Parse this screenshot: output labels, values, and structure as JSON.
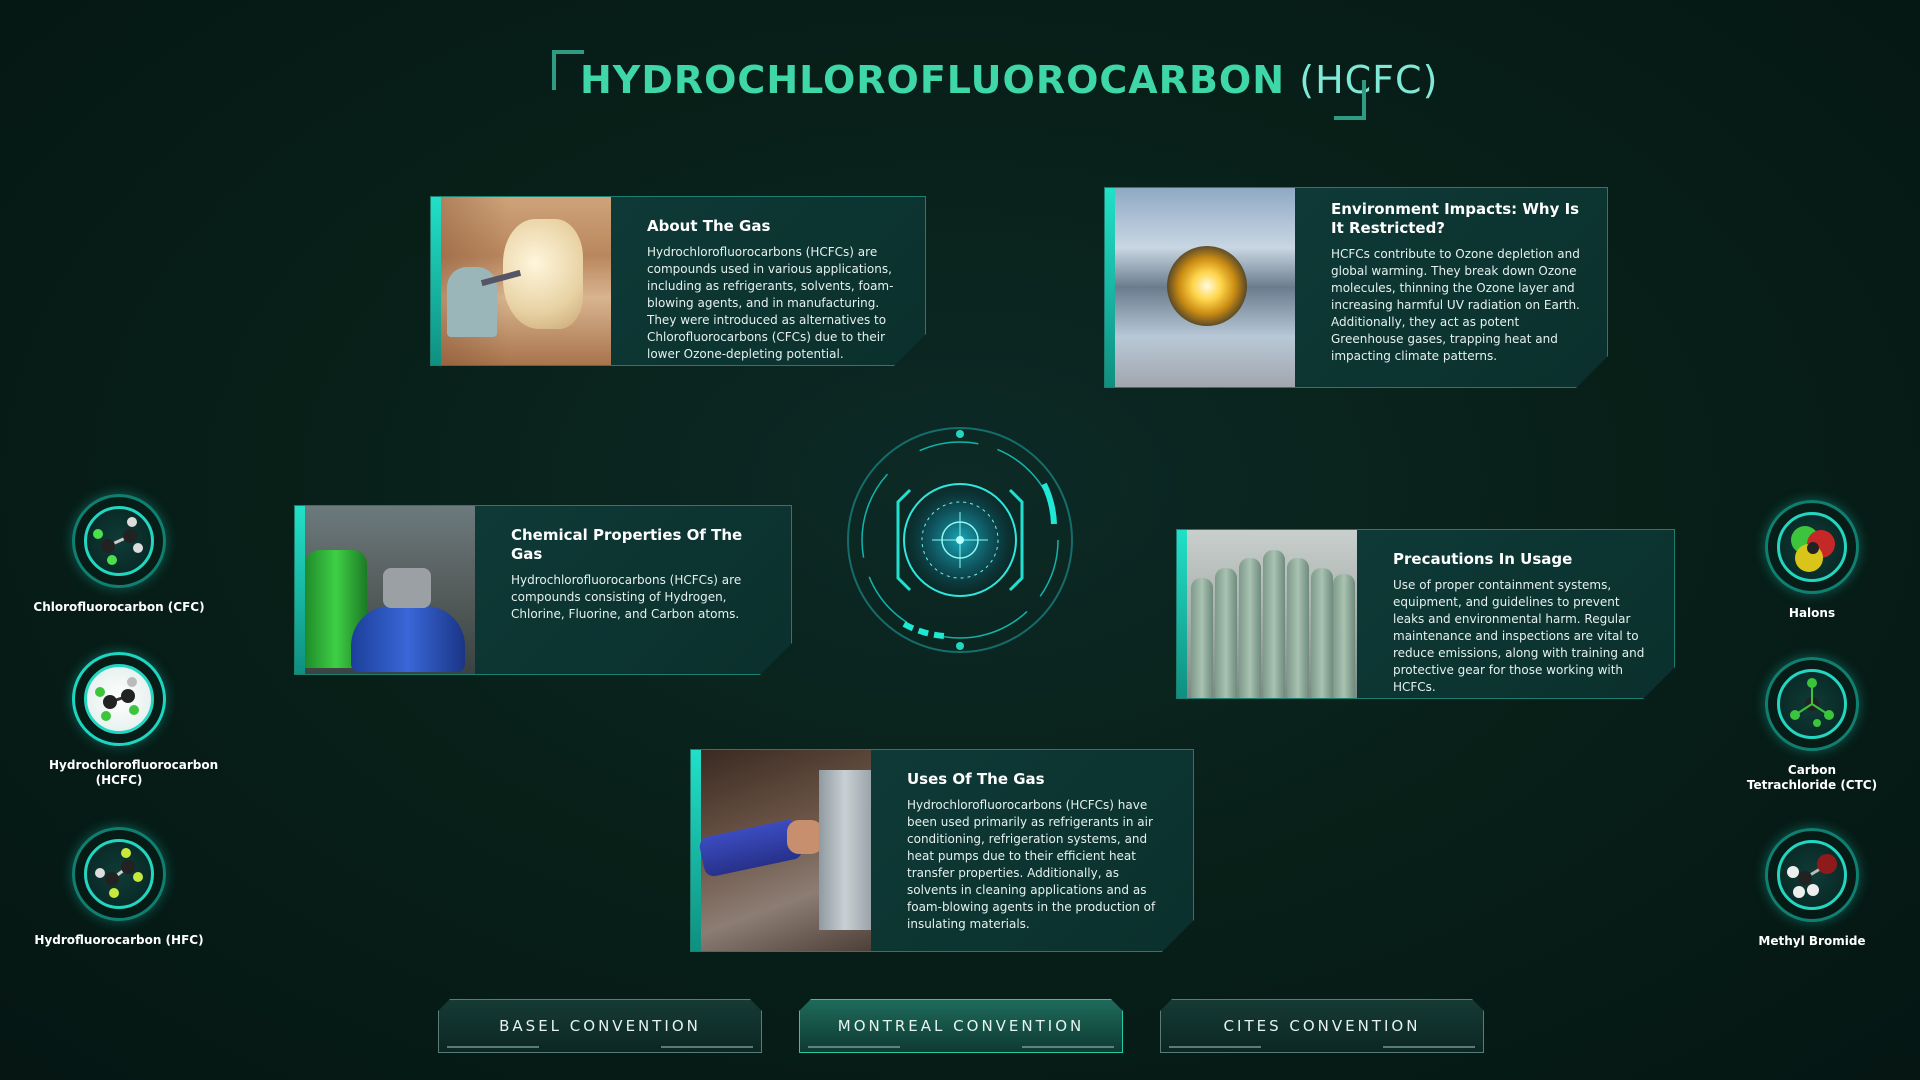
{
  "title": {
    "main": "HYDROCHLOROFLUOROCARBON",
    "abbr": "(HCFC)"
  },
  "cards": {
    "about": {
      "heading": "About The Gas",
      "body": "Hydrochlorofluorocarbons (HCFCs) are compounds used in various applications, including as refrigerants, solvents, foam-blowing agents, and in manufacturing. They were introduced as alternatives to Chlorofluorocarbons (CFCs) due to their lower Ozone-depleting potential."
    },
    "environment": {
      "heading": "Environment Impacts: Why Is It Restricted?",
      "body": "HCFCs contribute to Ozone depletion and global warming. They break down Ozone molecules, thinning the Ozone layer and increasing harmful UV radiation on Earth. Additionally, they act as potent Greenhouse gases, trapping heat and impacting climate patterns."
    },
    "chemical": {
      "heading": "Chemical Properties Of The Gas",
      "body": "Hydrochlorofluorocarbons (HCFCs) are compounds consisting of Hydrogen, Chlorine, Fluorine, and Carbon atoms."
    },
    "precautions": {
      "heading": "Precautions In Usage",
      "body": "Use of proper containment systems, equipment, and guidelines to prevent leaks and environmental harm. Regular maintenance and inspections are vital to reduce emissions, along with training and protective gear for those working with HCFCs."
    },
    "uses": {
      "heading": "Uses Of The Gas",
      "body": "Hydrochlorofluorocarbons (HCFCs) have been used primarily as refrigerants in air conditioning, refrigeration systems, and heat pumps due to their efficient heat transfer properties. Additionally, as solvents in cleaning applications and as foam-blowing agents in the production of insulating materials."
    }
  },
  "gases_left": [
    {
      "label": "Chlorofluorocarbon (CFC)",
      "icon": "cfc-molecule-icon"
    },
    {
      "label": "Hydrochlorofluorocarbon (HCFC)",
      "icon": "hcfc-molecule-icon"
    },
    {
      "label": "Hydrofluorocarbon (HFC)",
      "icon": "hfc-molecule-icon"
    }
  ],
  "gases_right": [
    {
      "label": "Halons",
      "icon": "halons-molecule-icon"
    },
    {
      "label": "Carbon Tetrachloride (CTC)",
      "icon": "ctc-molecule-icon"
    },
    {
      "label": "Methyl Bromide",
      "icon": "methyl-bromide-molecule-icon"
    }
  ],
  "conventions": [
    {
      "label": "BASEL CONVENTION",
      "active": false
    },
    {
      "label": "MONTREAL CONVENTION",
      "active": true
    },
    {
      "label": "CITES CONVENTION",
      "active": false
    }
  ],
  "colors": {
    "accent": "#22e0c8",
    "title": "#3fd6a8",
    "card_bg": "#0f3d3a",
    "background": "#051613"
  }
}
